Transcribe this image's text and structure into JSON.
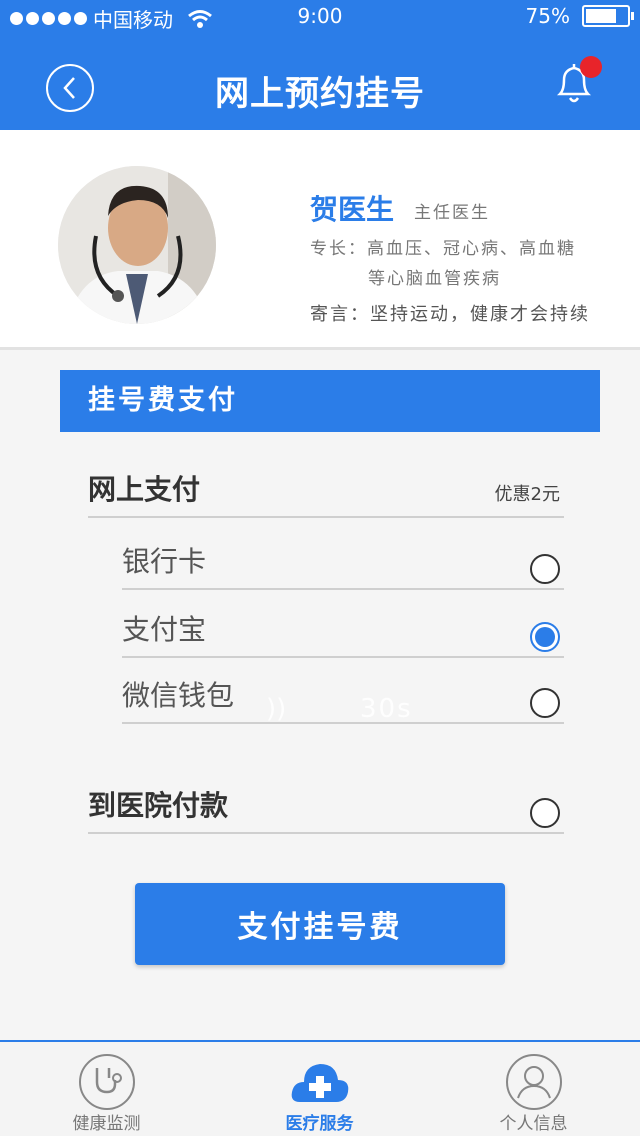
{
  "status_bar": {
    "carrier": "中国移动",
    "time": "9:00",
    "battery": "75%",
    "battery_level": 0.75
  },
  "nav": {
    "title": "网上预约挂号",
    "back_icon": "chevron-left-icon",
    "bell_icon": "bell-icon"
  },
  "doctor": {
    "name": "贺医生",
    "title": "主任医生",
    "specialty_line1": "专长：高血压、冠心病、高血糖",
    "specialty_line2": "等心脑血管疾病",
    "motto": "寄言：坚持运动，健康才会持续"
  },
  "payment": {
    "section_title": "挂号费支付",
    "online_label": "网上支付",
    "online_discount": "优惠2元",
    "options": [
      {
        "label": "银行卡",
        "checked": false
      },
      {
        "label": "支付宝",
        "checked": true
      },
      {
        "label": "微信钱包",
        "checked": false
      }
    ],
    "hospital_label": "到医院付款",
    "hospital_checked": false,
    "pay_button": "支付挂号费"
  },
  "overlay": {
    "voice_icon": "))",
    "voice_time": "30s"
  },
  "tabs": [
    {
      "label": "健康监测",
      "icon": "stethoscope-icon",
      "active": false
    },
    {
      "label": "医疗服务",
      "icon": "medical-cloud-icon",
      "active": true
    },
    {
      "label": "个人信息",
      "icon": "user-icon",
      "active": false
    }
  ],
  "colors": {
    "primary": "#2b7de8",
    "notification": "#e8242a"
  }
}
